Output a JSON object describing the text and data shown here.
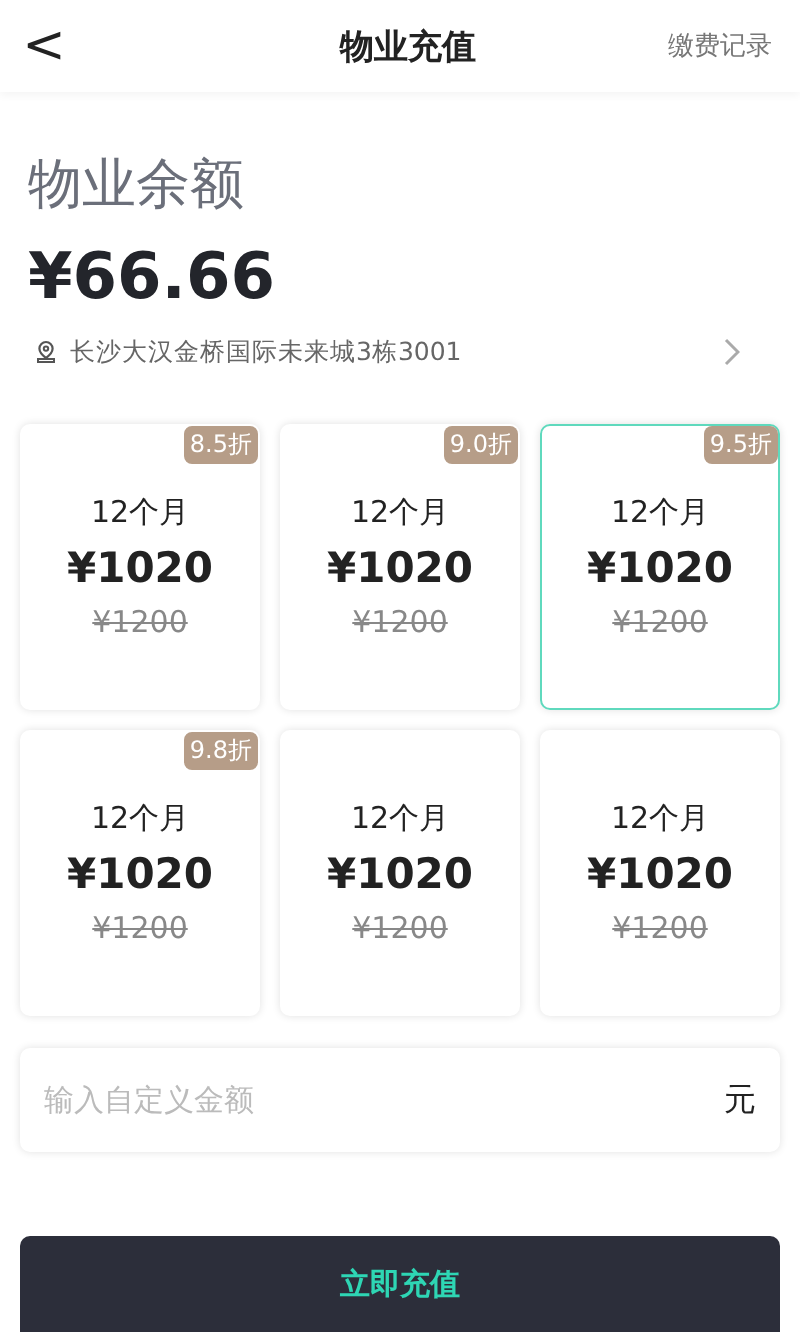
{
  "header": {
    "back": "<",
    "title": "物业充值",
    "action": "缴费记录"
  },
  "balance": {
    "label": "物业余额",
    "amount": "¥66.66",
    "address": "长沙大汉金桥国际未来城3栋3001"
  },
  "plans": [
    {
      "period": "12个月",
      "price": "¥1020",
      "original": "¥1200",
      "discount": "8.5折",
      "selected": false
    },
    {
      "period": "12个月",
      "price": "¥1020",
      "original": "¥1200",
      "discount": "9.0折",
      "selected": false
    },
    {
      "period": "12个月",
      "price": "¥1020",
      "original": "¥1200",
      "discount": "9.5折",
      "selected": true
    },
    {
      "period": "12个月",
      "price": "¥1020",
      "original": "¥1200",
      "discount": "9.8折",
      "selected": false
    },
    {
      "period": "12个月",
      "price": "¥1020",
      "original": "¥1200",
      "selected": false
    },
    {
      "period": "12个月",
      "price": "¥1020",
      "original": "¥1200",
      "selected": false
    }
  ],
  "custom": {
    "placeholder": "输入自定义金额",
    "unit": "元"
  },
  "submit": "立即充值"
}
